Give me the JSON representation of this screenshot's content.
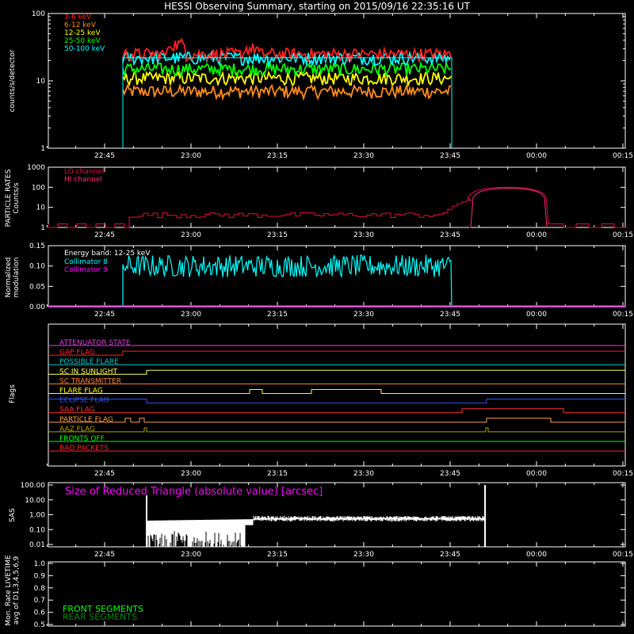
{
  "title": "HESSI Observing Summary, starting on 2015/09/16 22:35:16 UT",
  "time_ticks": [
    "22:45",
    "23:00",
    "23:15",
    "23:30",
    "23:45",
    "00:00",
    "00:15"
  ],
  "colors": {
    "background": "#000000",
    "axes": "#ffffff"
  },
  "chart_data": [
    {
      "type": "line",
      "name": "count-rates",
      "ylabel": "counts/s/detector",
      "yscale": "log",
      "ylim": [
        1,
        100
      ],
      "ytick_labels": [
        "1",
        "10",
        "100"
      ],
      "data_start": "22:47:30",
      "data_end": "23:45:00",
      "series": [
        {
          "name": "3-6 keV",
          "color": "#ff2020",
          "level": 25
        },
        {
          "name": "6-12 keV",
          "color": "#ff8c1a",
          "level": 7
        },
        {
          "name": "12-25 keV",
          "color": "#ffff00",
          "level": 11
        },
        {
          "name": "25-50 keV",
          "color": "#00ff00",
          "level": 15
        },
        {
          "name": "50-100 keV",
          "color": "#00ffff",
          "level": 22
        }
      ]
    },
    {
      "type": "line",
      "name": "particle-rates",
      "ylabel_lines": [
        "PARTICLE RATES",
        "Counts/s"
      ],
      "yscale": "log",
      "ylim": [
        1,
        1000
      ],
      "ytick_labels": [
        "1",
        "10",
        "100",
        "1000"
      ],
      "series": [
        {
          "name": "LO channel",
          "color": "#e0103c",
          "level": 5
        },
        {
          "name": "HI channel",
          "color": "#ff2a80",
          "peak": 100
        }
      ]
    },
    {
      "type": "line",
      "name": "modulation",
      "ylabel_lines": [
        "Normalized",
        "modulation"
      ],
      "ylim": [
        0,
        0.15
      ],
      "ytick_labels": [
        "0.00",
        "0.05",
        "0.10",
        "0.15"
      ],
      "legend_title": "Energy band: 12-25 keV",
      "series": [
        {
          "name": "Collimator 8",
          "color": "#00ffff",
          "level": 0.1
        },
        {
          "name": "Collimator 9",
          "color": "#ff00ff",
          "level": 0.0
        }
      ]
    },
    {
      "type": "line",
      "name": "flags",
      "ylabel": "Flags",
      "flags": [
        {
          "name": "ATTENUATOR STATE",
          "color": "#e040e0"
        },
        {
          "name": "GAP FLAG",
          "color": "#ff2020"
        },
        {
          "name": "POSSIBLE FLARE",
          "color": "#00c8c8"
        },
        {
          "name": "SC IN SUNLIGHT",
          "color": "#ffff60"
        },
        {
          "name": "SC TRANSMITTER",
          "color": "#ff8030"
        },
        {
          "name": "FLARE FLAG",
          "color": "#ffff00"
        },
        {
          "name": "ECLIPSE FLAG",
          "color": "#3050ff"
        },
        {
          "name": "SAA FLAG",
          "color": "#ff3030"
        },
        {
          "name": "PARTICLE FLAG",
          "color": "#ffa040"
        },
        {
          "name": "AAZ FLAG",
          "color": "#b0a000"
        },
        {
          "name": "FRONTS OFF",
          "color": "#00ff00"
        },
        {
          "name": "BAD PACKETS",
          "color": "#ff2020"
        }
      ]
    },
    {
      "type": "line",
      "name": "sas",
      "ylabel": "SAS",
      "yscale": "log",
      "ylim": [
        0.01,
        100
      ],
      "ytick_labels": [
        "0.01",
        "0.10",
        "1.00",
        "10.00",
        "100.00"
      ],
      "annotation": "Size of Reduced Triangle (absolute value) [arcsec]",
      "annotation_color": "#ff00ff",
      "series": [
        {
          "name": "triangle",
          "color": "#ffffff",
          "level": 0.6
        }
      ]
    },
    {
      "type": "line",
      "name": "livetime",
      "ylabel_lines": [
        "Mon. Rate LIVETIME",
        "avg of D1,3,4,5,6,9"
      ],
      "ylim": [
        0.5,
        1.0
      ],
      "ytick_labels": [
        "0.5",
        "0.6",
        "0.7",
        "0.8",
        "0.9",
        "1.0"
      ],
      "series": [
        {
          "name": "FRONT SEGMENTS",
          "color": "#00ff00"
        },
        {
          "name": "REAR SEGMENTS",
          "color": "#008c00"
        }
      ]
    }
  ]
}
